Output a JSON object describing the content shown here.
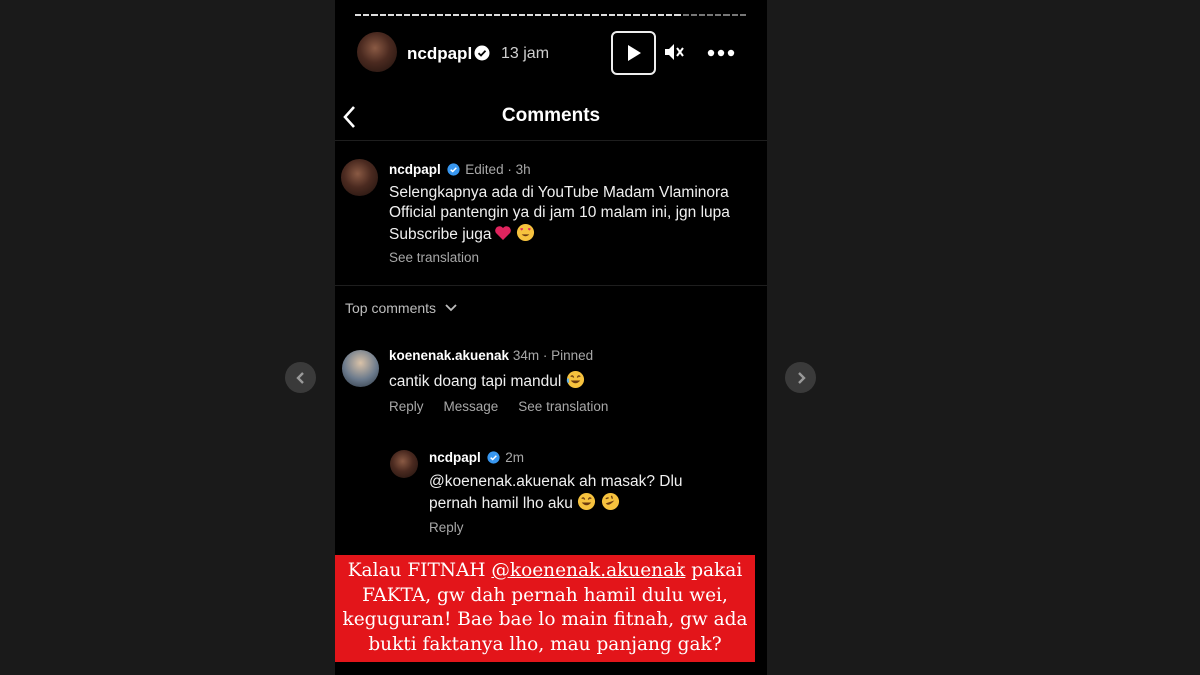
{
  "story": {
    "username": "ncdpapl",
    "time": "13 jam"
  },
  "panel": {
    "title": "Comments"
  },
  "caption": {
    "username": "ncdpapl",
    "meta": "Edited · 3h",
    "text": "Selengkapnya ada di YouTube Madam Vlaminora Official pantengin ya di jam 10 malam ini, jgn lupa Subscribe juga",
    "see_translation": "See translation"
  },
  "sort": {
    "label": "Top comments"
  },
  "comments": [
    {
      "username": "koenenak.akuenak",
      "meta": "34m · Pinned",
      "text": "cantik doang tapi mandul",
      "actions": [
        "Reply",
        "Message",
        "See translation"
      ]
    }
  ],
  "reply": {
    "username": "ncdpapl",
    "meta": "2m",
    "text": "@koenenak.akuenak ah masak? Dlu pernah hamil lho aku",
    "action": "Reply"
  },
  "overlay": {
    "line1_prefix": "Kalau FITNAH ",
    "line1_mention": "@koenenak.akuenak",
    "rest": "pakai FAKTA, gw dah pernah hamil dulu wei, keguguran! Bae bae lo main fitnah, gw ada bukti faktanya lho, mau panjang gak?"
  },
  "colors": {
    "overlay_bg": "#e3151a",
    "verified": "#3897f0",
    "background": "#000000"
  }
}
